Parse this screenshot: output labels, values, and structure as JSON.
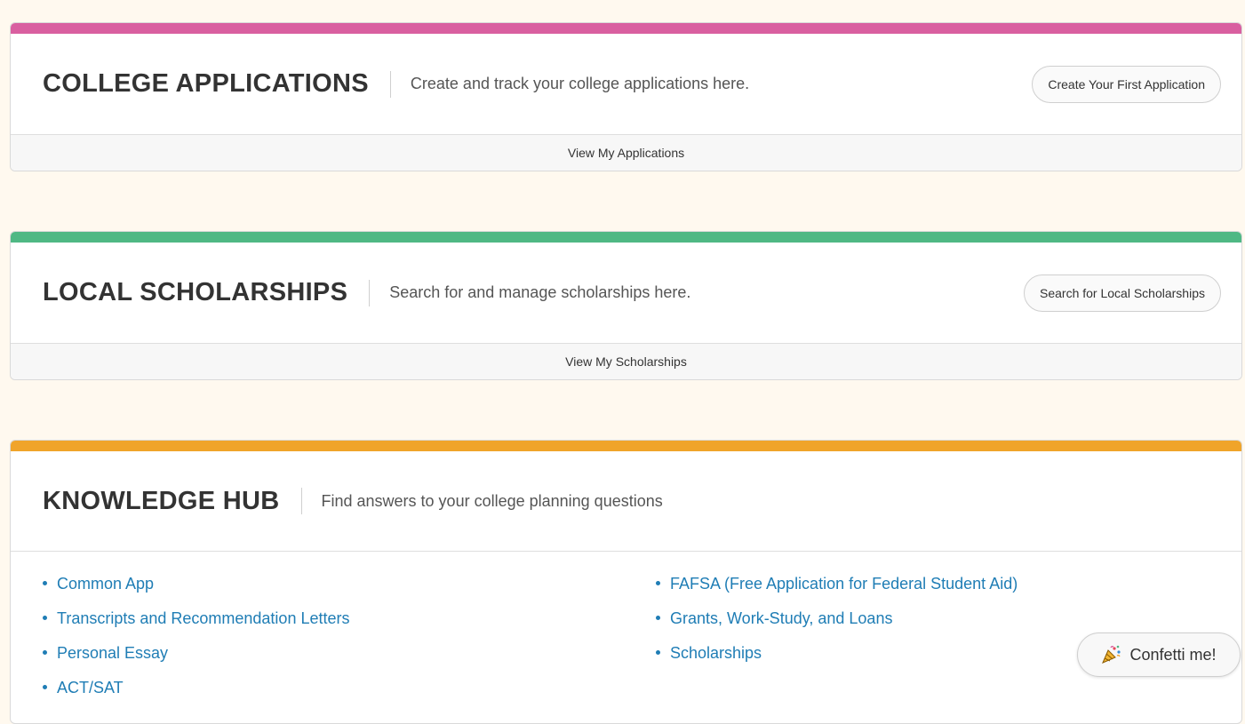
{
  "college_applications": {
    "title": "COLLEGE APPLICATIONS",
    "description": "Create and track your college applications here.",
    "button_label": "Create Your First Application",
    "footer_link": "View My Applications",
    "accent_color": "#d95fa0"
  },
  "local_scholarships": {
    "title": "LOCAL SCHOLARSHIPS",
    "description": "Search for and manage scholarships here.",
    "button_label": "Search for Local Scholarships",
    "footer_link": "View My Scholarships",
    "accent_color": "#4fb884"
  },
  "knowledge_hub": {
    "title": "KNOWLEDGE HUB",
    "description": "Find answers to your college planning questions",
    "accent_color": "#f0a42a",
    "left_links": [
      "Common App",
      "Transcripts and Recommendation Letters",
      "Personal Essay",
      "ACT/SAT"
    ],
    "right_links": [
      "FAFSA (Free Application for Federal Student Aid)",
      "Grants, Work-Study, and Loans",
      "Scholarships"
    ]
  },
  "confetti_button": {
    "label": "Confetti me!",
    "icon": "party-popper-icon"
  },
  "colors": {
    "page_background": "#fff9ef",
    "link_color": "#1f7db5"
  }
}
